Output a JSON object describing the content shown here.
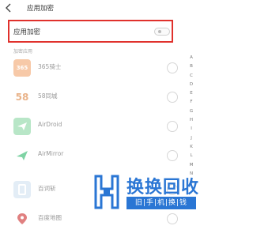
{
  "header": {
    "title": "应用加密"
  },
  "toggle": {
    "label": "应用加密",
    "enabled": false
  },
  "section": {
    "title": "加密应用"
  },
  "apps": [
    {
      "name": "365骑士",
      "icon": "365-icon",
      "icon_text": "365",
      "icon_bg": "#f7c9a8",
      "icon_fg": "#ffffff",
      "selected": false
    },
    {
      "name": "58同城",
      "icon": "58-icon",
      "icon_text": "58",
      "icon_bg": "#ffffff",
      "icon_fg": "#e9b38a",
      "selected": false
    },
    {
      "name": "AirDroid",
      "icon": "airdroid-icon",
      "icon_text": "",
      "icon_bg": "#b8e6c7",
      "icon_fg": "#ffffff",
      "selected": false
    },
    {
      "name": "AirMirror",
      "icon": "airmirror-icon",
      "icon_text": "",
      "icon_bg": "#ffffff",
      "icon_fg": "#7fd3a4",
      "selected": false
    },
    {
      "name": "百词斩",
      "icon": "baicizhan-icon",
      "icon_text": "",
      "icon_bg": "#e3edf6",
      "icon_fg": "#ffffff",
      "selected": false
    },
    {
      "name": "百度地图",
      "icon": "baidu-map-icon",
      "icon_text": "",
      "icon_bg": "#ffffff",
      "icon_fg": "#e08080",
      "selected": false
    }
  ],
  "index_letters": [
    "A",
    "B",
    "C",
    "D",
    "E",
    "F",
    "G",
    "H",
    "I",
    "J",
    "K",
    "L",
    "M",
    "N",
    "O"
  ],
  "watermark": {
    "title": "换换回收",
    "subtitle": "旧|手|机|换|钱",
    "color": "#2a76d4"
  }
}
